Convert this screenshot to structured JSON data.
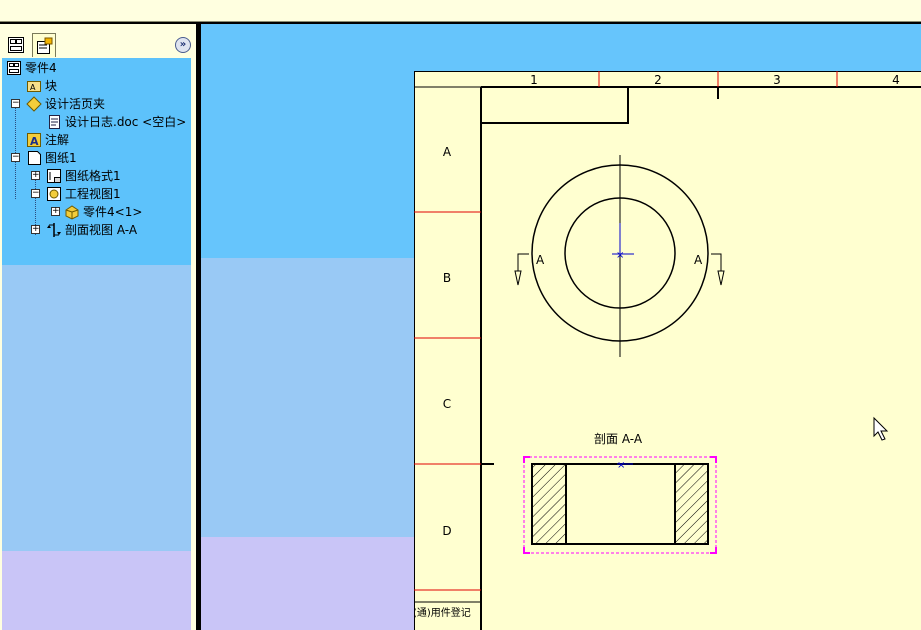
{
  "tree": {
    "tabs": [
      "feature-manager",
      "property-manager"
    ],
    "collapse_glyph": "»",
    "items": [
      {
        "label": "零件4",
        "icon": "drawing-doc-icon"
      },
      {
        "label": "块",
        "icon": "block-icon"
      },
      {
        "label": "设计活页夹",
        "icon": "binder-icon"
      },
      {
        "label": "设计日志.doc <空白>",
        "icon": "document-icon"
      },
      {
        "label": "注解",
        "icon": "annotation-icon"
      },
      {
        "label": "图纸1",
        "icon": "sheet-icon"
      },
      {
        "label": "图纸格式1",
        "icon": "sheet-format-icon"
      },
      {
        "label": "工程视图1",
        "icon": "drawing-view-icon"
      },
      {
        "label": "零件4<1>",
        "icon": "part-icon"
      },
      {
        "label": "剖面视图 A-A",
        "icon": "section-view-icon"
      }
    ]
  },
  "drawing": {
    "column_labels": [
      "1",
      "2",
      "3",
      "4"
    ],
    "row_labels": [
      "A",
      "B",
      "C",
      "D"
    ],
    "section_marker_left": "A",
    "section_marker_right": "A",
    "section_title": "剖面 A-A",
    "title_block_text": "借(通)用件登记",
    "colors": {
      "sheet": "#FFFFD0",
      "zone_line": "#E00000",
      "selection": "#FF00FF",
      "axis": "#0000CC"
    }
  }
}
